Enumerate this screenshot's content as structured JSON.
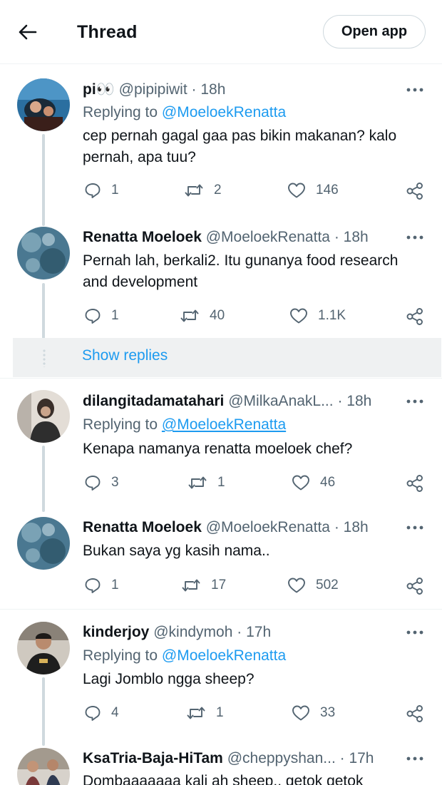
{
  "header": {
    "title": "Thread",
    "open_app": "Open app"
  },
  "tweets": [
    {
      "name": "pi👀",
      "handle": "@pipipiwit",
      "time": "· 18h",
      "replying_prefix": "Replying to",
      "replying_to": "@MoeloekRenatta",
      "text": "cep pernah gagal gaa pas bikin makanan? kalo pernah, apa tuu?",
      "replies": "1",
      "retweets": "2",
      "likes": "146"
    },
    {
      "name": "Renatta Moeloek",
      "handle": "@MoeloekRenatta",
      "time": "· 18h",
      "text": "Pernah lah, berkali2. Itu gunanya food research and development",
      "replies": "1",
      "retweets": "40",
      "likes": "1.1K"
    },
    {
      "name": "dilangitadamatahari",
      "handle": "@MilkaAnakL...",
      "time": "· 18h",
      "replying_prefix": "Replying to",
      "replying_to": "@MoeloekRenatta",
      "text": "Kenapa namanya renatta moeloek chef?",
      "replies": "3",
      "retweets": "1",
      "likes": "46"
    },
    {
      "name": "Renatta Moeloek",
      "handle": "@MoeloekRenatta",
      "time": "· 18h",
      "text": "Bukan saya yg kasih nama..",
      "replies": "1",
      "retweets": "17",
      "likes": "502"
    },
    {
      "name": "kinderjoy",
      "handle": "@kindymoh",
      "time": "· 17h",
      "replying_prefix": "Replying to",
      "replying_to": "@MoeloekRenatta",
      "text": "Lagi Jomblo ngga sheep?",
      "replies": "4",
      "retweets": "1",
      "likes": "33"
    },
    {
      "name": "KsaTria-Baja-HiTam",
      "handle": "@cheppyshan...",
      "time": "· 17h",
      "text": "Dombaaaaaaa kali ah sheep.. getok getok"
    }
  ],
  "show_replies": "Show replies",
  "icons": {
    "back": "arrow-left-icon",
    "more": "more-dots-icon",
    "reply": "reply-icon",
    "retweet": "retweet-icon",
    "like": "heart-icon",
    "share": "share-icon"
  },
  "colors": {
    "link": "#1d9bf0",
    "secondary_text": "#536471",
    "primary_text": "#0f1419"
  }
}
